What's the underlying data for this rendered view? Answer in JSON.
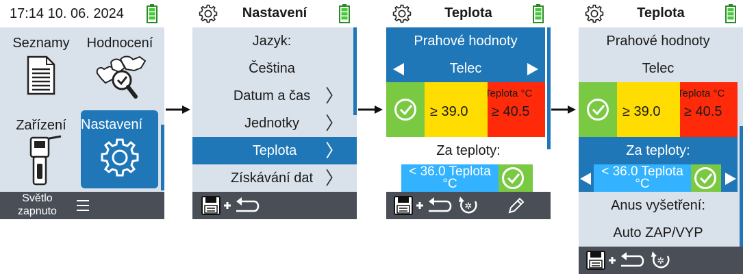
{
  "screen1": {
    "time": "17:14 10. 06. 2024",
    "tiles": {
      "lists": "Seznamy",
      "evaluation": "Hodnocení",
      "device": "Zařízení",
      "settings": "Nastavení"
    },
    "footer": {
      "light_line1": "Světlo",
      "light_line2": "zapnuto"
    }
  },
  "screen2": {
    "title": "Nastavení",
    "items": [
      {
        "label": "Jazyk:"
      },
      {
        "label": "Čeština"
      },
      {
        "label": "Datum a čas"
      },
      {
        "label": "Jednotky"
      },
      {
        "label": "Teplota"
      },
      {
        "label": "Získávání dat"
      }
    ],
    "selected_index": 4
  },
  "screen3": {
    "title": "Teplota",
    "threshold_heading": "Prahové hodnoty",
    "animal": "Telec",
    "thresholds": {
      "yellow": "≥ 39.0",
      "red": "≥ 40.5",
      "red_label": "Teplota °C"
    },
    "below_heading": "Za teploty:",
    "below_value_line1": "< 36.0 Teplota",
    "below_value_line2": "°C"
  },
  "screen4": {
    "title": "Teplota",
    "threshold_heading": "Prahové hodnoty",
    "animal": "Telec",
    "thresholds": {
      "yellow": "≥ 39.0",
      "red": "≥ 40.5",
      "red_label": "Teplota °C"
    },
    "below_heading": "Za teploty:",
    "below_value_line1": "< 36.0 Teplota",
    "below_value_line2": "°C",
    "anus_label": "Anus vyšetření:",
    "anus_value": "Auto ZAP/VYP"
  },
  "colors": {
    "panel_bg": "#d9e1ea",
    "selection_blue": "#1f77b8",
    "footer_gray": "#4a4f57",
    "green": "#7ac943",
    "yellow": "#ffdd00",
    "red": "#ff2a0a",
    "light_blue": "#33b3ff"
  }
}
